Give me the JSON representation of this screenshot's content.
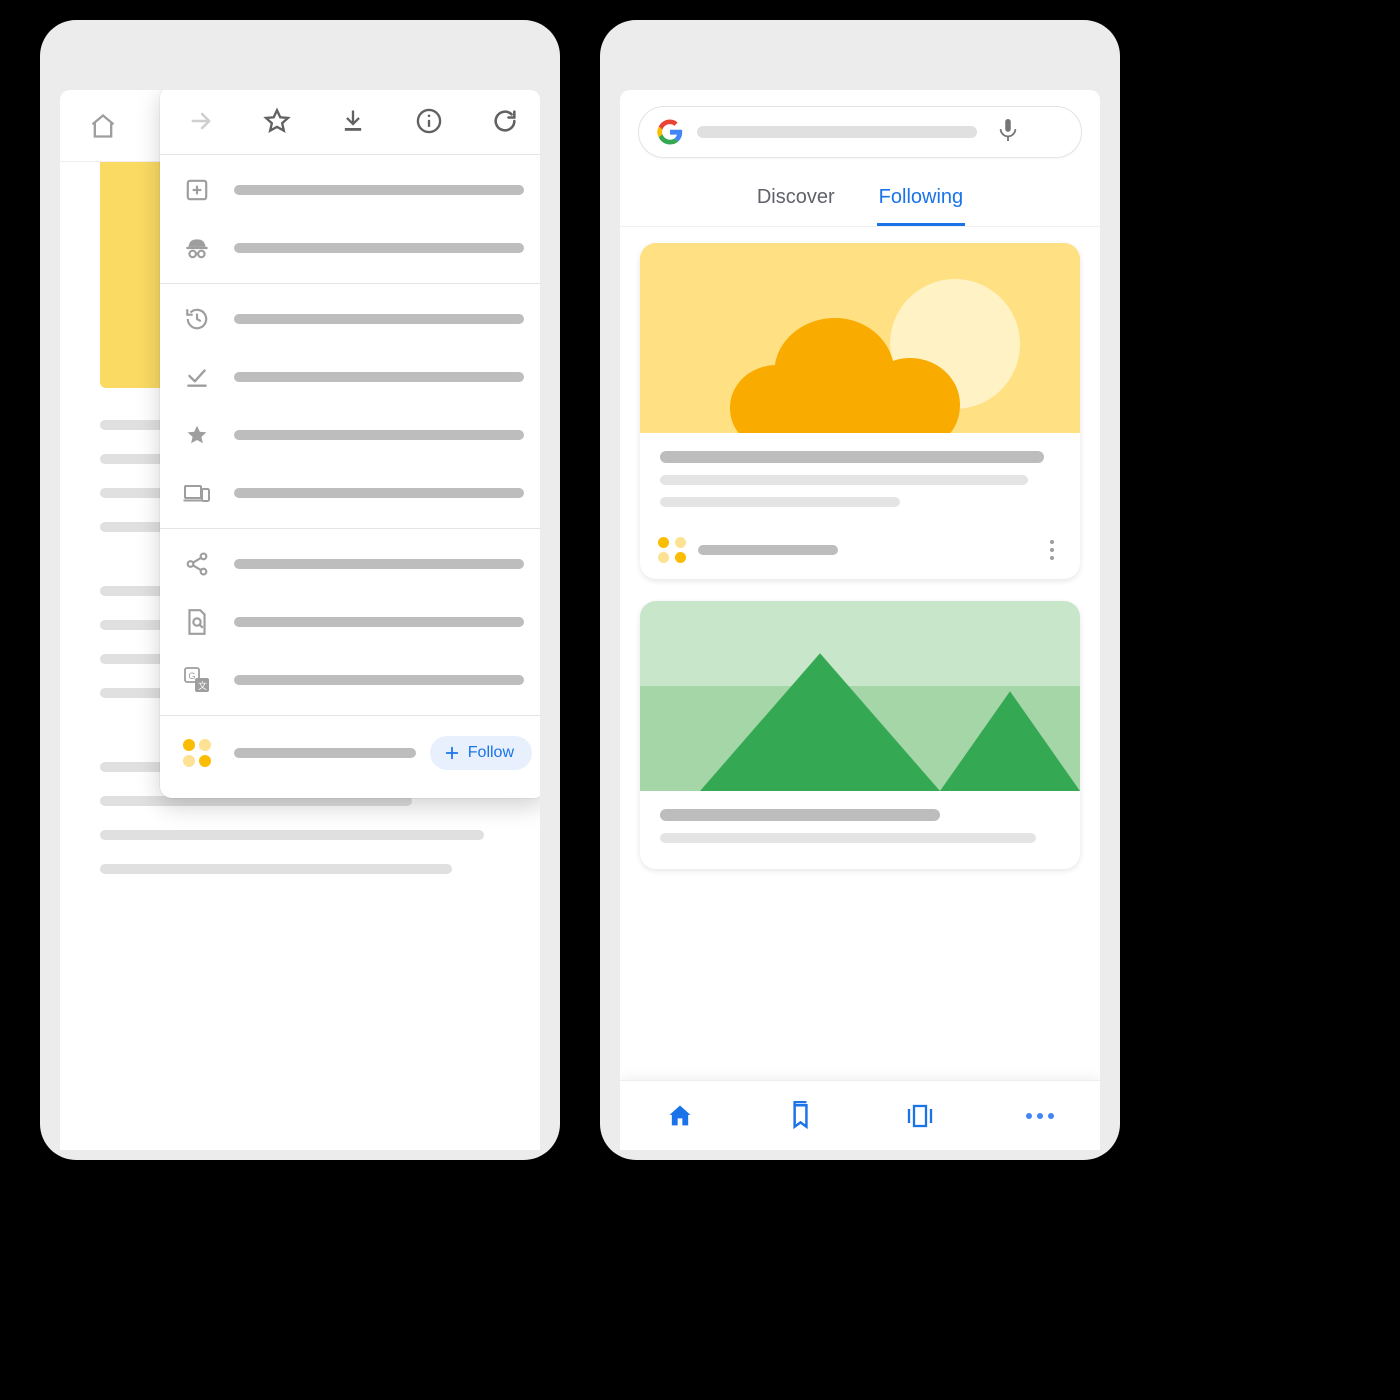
{
  "left_phone": {
    "topbar": {
      "home_icon": "home-icon"
    },
    "menu": {
      "top_icons": [
        "forward-icon",
        "star-icon",
        "download-icon",
        "info-icon",
        "refresh-icon"
      ],
      "group1": [
        {
          "icon": "new-tab-icon",
          "text_width": "48%"
        },
        {
          "icon": "incognito-icon",
          "text_width": "76%"
        }
      ],
      "group2": [
        {
          "icon": "history-icon",
          "text_width": "50%"
        },
        {
          "icon": "downloads-done-icon",
          "text_width": "72%"
        },
        {
          "icon": "bookmarks-icon",
          "text_width": "70%"
        },
        {
          "icon": "devices-icon",
          "text_width": "62%"
        }
      ],
      "group3": [
        {
          "icon": "share-icon",
          "text_width": "42%"
        },
        {
          "icon": "find-in-page-icon",
          "text_width": "66%"
        },
        {
          "icon": "translate-icon",
          "text_width": "58%"
        }
      ],
      "follow_row": {
        "icon": "publisher-icon",
        "text_width": "38%",
        "chip_label": "Follow"
      }
    }
  },
  "right_phone": {
    "search": {
      "logo": "google-logo",
      "placeholder_width": "62%",
      "mic": "mic-icon"
    },
    "tabs": {
      "discover": "Discover",
      "following": "Following",
      "active": "following"
    },
    "cards": [
      {
        "image": "sun-cloud",
        "kebab": "more-icon"
      },
      {
        "image": "hills",
        "kebab": "more-icon"
      }
    ],
    "bottom_nav": [
      "home-icon",
      "bookmarks-icon",
      "tab-switcher-icon",
      "more-icon"
    ]
  }
}
